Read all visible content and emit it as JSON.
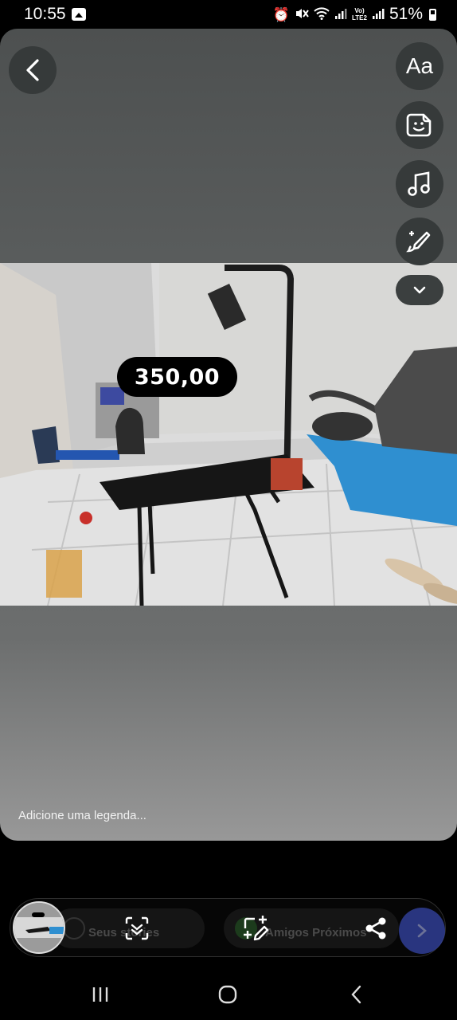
{
  "status_bar": {
    "time": "10:55",
    "battery": "51%",
    "volte_top": "Vo)",
    "volte_bottom": "LTE2",
    "icons": [
      "gallery-icon",
      "alarm-icon",
      "mute-icon",
      "wifi-icon",
      "signal-icon",
      "battery-icon"
    ]
  },
  "editor": {
    "text_tool_label": "Aa",
    "price_sticker": "350,00",
    "caption_placeholder": "Adicione uma legenda...",
    "tool_icons": [
      "text-icon",
      "sticker-icon",
      "music-icon",
      "draw-icon",
      "chevron-down-icon"
    ]
  },
  "share_bar": {
    "story_label": "Seus stories",
    "close_friends_label": "Amigos Próximos",
    "icons": [
      "scan-icon",
      "add-edit-icon",
      "share-icon",
      "next-icon"
    ]
  },
  "nav_bar": {
    "icons": [
      "recent-apps-icon",
      "home-icon",
      "back-icon"
    ]
  },
  "colors": {
    "canvas_top": "#4d5050",
    "canvas_bottom": "#989898",
    "button_bg": "#363a3a",
    "next_button": "#3545a8"
  }
}
